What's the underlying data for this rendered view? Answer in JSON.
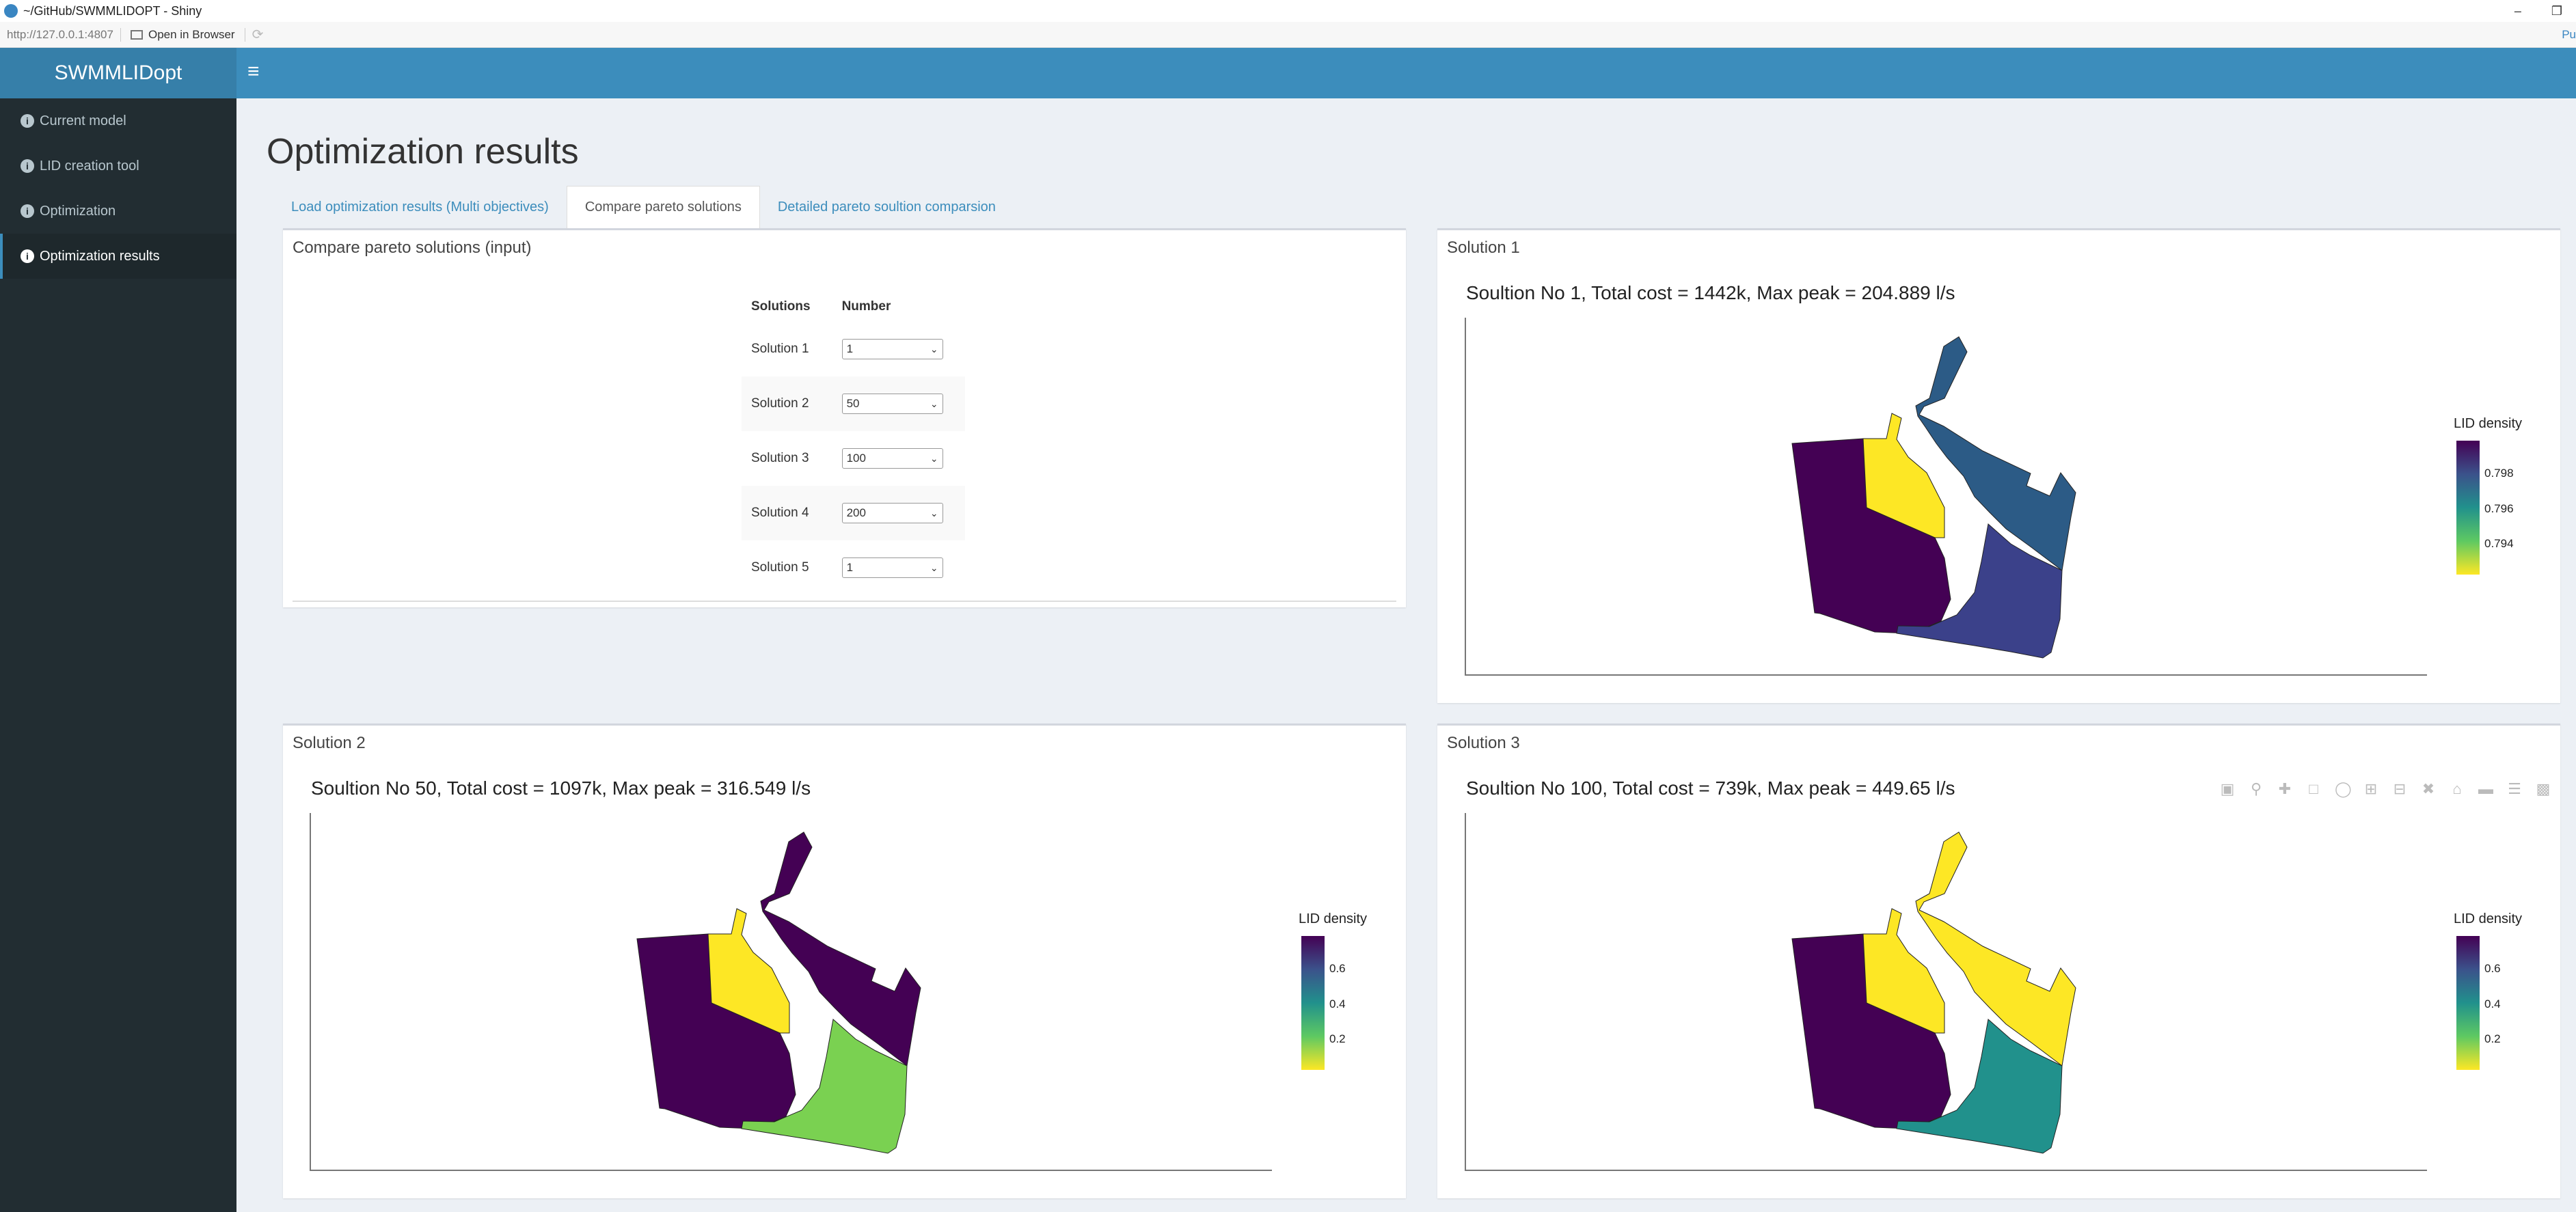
{
  "window": {
    "title": "~/GitHub/SWMMLIDOPT - Shiny",
    "url": "http://127.0.0.1:4807",
    "open_in_browser": "Open in Browser",
    "publish": "Pu"
  },
  "brand": "SWMMLIDopt",
  "sidebar": {
    "items": [
      {
        "label": "Current model",
        "active": false
      },
      {
        "label": "LID creation tool",
        "active": false
      },
      {
        "label": "Optimization",
        "active": false
      },
      {
        "label": "Optimization results",
        "active": true
      }
    ]
  },
  "page_title": "Optimization results",
  "tabs": [
    {
      "label": "Load optimization results (Multi objectives)",
      "active": false
    },
    {
      "label": "Compare pareto solutions",
      "active": true
    },
    {
      "label": "Detailed pareto soultion comparsion",
      "active": false
    }
  ],
  "input_panel": {
    "title": "Compare pareto solutions (input)",
    "headers": [
      "Solutions",
      "Number"
    ],
    "rows": [
      {
        "label": "Solution 1",
        "value": "1"
      },
      {
        "label": "Solution 2",
        "value": "50"
      },
      {
        "label": "Solution 3",
        "value": "100"
      },
      {
        "label": "Solution 4",
        "value": "200"
      },
      {
        "label": "Solution 5",
        "value": "1"
      }
    ]
  },
  "colors": {
    "dark_purple": "#440154",
    "blue_dark": "#2c5b86",
    "blue_purple": "#3b418a",
    "yellow": "#fde725",
    "green": "#7ad151",
    "teal": "#21918c"
  },
  "solutions": [
    {
      "box_title": "Solution 1",
      "plot_title": "Soultion No 1, Total cost = 1442k, Max peak = 204.889 l/s",
      "legend_title": "LID density",
      "legend_ticks": [
        "0.798",
        "0.796",
        "0.794"
      ]
    },
    {
      "box_title": "Solution 2",
      "plot_title": "Soultion No 50, Total cost = 1097k, Max peak = 316.549 l/s",
      "legend_title": "LID density",
      "legend_ticks": [
        "0.6",
        "0.4",
        "0.2"
      ]
    },
    {
      "box_title": "Solution 3",
      "plot_title": "Soultion No 100, Total cost = 739k, Max peak = 449.65 l/s",
      "legend_title": "LID density",
      "legend_ticks": [
        "0.6",
        "0.4",
        "0.2"
      ]
    }
  ]
}
